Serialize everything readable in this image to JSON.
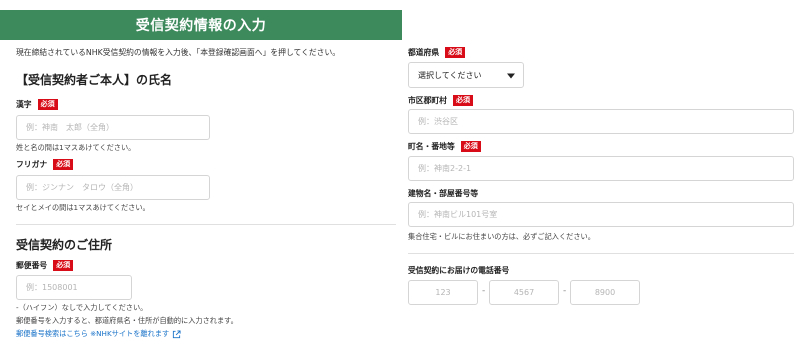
{
  "banner": {
    "title": "受信契約情報の入力"
  },
  "intro": "現在締結されているNHK受信契約の情報を入力後、「本登録確認画面へ」を押してください。",
  "required_label": "必須",
  "name_section": {
    "heading": "【受信契約者ご本人】の氏名",
    "kanji": {
      "label": "漢字",
      "placeholder": "例：神南　太郎（全角）",
      "note": "姓と名の間は1マスあけてください。"
    },
    "furigana": {
      "label": "フリガナ",
      "placeholder": "例：ジンナン　タロウ（全角）",
      "note": "セイとメイの間は1マスあけてください。"
    }
  },
  "address_section": {
    "heading": "受信契約のご住所",
    "postal": {
      "label": "郵便番号",
      "placeholder": "例：1508001",
      "note1": "-（ハイフン）なしで入力してください。",
      "note2": "郵便番号を入力すると、都道府県名・住所が自動的に入力されます。",
      "search_link": "郵便番号検索はこちら ※NHKサイトを離れます"
    },
    "prefecture": {
      "label": "都道府県",
      "selected": "選択してください"
    },
    "city": {
      "label": "市区郡町村",
      "placeholder": "例：渋谷区"
    },
    "town": {
      "label": "町名・番地等",
      "placeholder": "例：神南2-2-1"
    },
    "building": {
      "label": "建物名・部屋番号等",
      "placeholder": "例：神南ビル101号室",
      "note": "集合住宅・ビルにお住まいの方は、必ずご記入ください。"
    }
  },
  "phone": {
    "label": "受信契約にお届けの電話番号",
    "part1_placeholder": "123",
    "part2_placeholder": "4567",
    "part3_placeholder": "8900",
    "separator": "-"
  }
}
